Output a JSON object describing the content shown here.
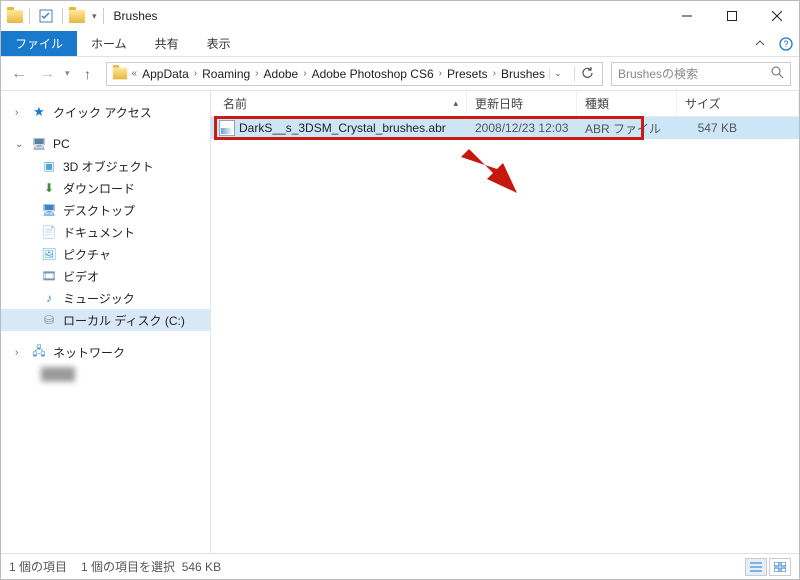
{
  "window": {
    "title": "Brushes"
  },
  "ribbon": {
    "file": "ファイル",
    "tabs": [
      "ホーム",
      "共有",
      "表示"
    ]
  },
  "breadcrumb": {
    "prefix": "«",
    "items": [
      "AppData",
      "Roaming",
      "Adobe",
      "Adobe Photoshop CS6",
      "Presets",
      "Brushes"
    ]
  },
  "search": {
    "placeholder": "Brushesの検索"
  },
  "sidebar": {
    "quick_access": "クイック アクセス",
    "pc": "PC",
    "pc_children": [
      "3D オブジェクト",
      "ダウンロード",
      "デスクトップ",
      "ドキュメント",
      "ピクチャ",
      "ビデオ",
      "ミュージック",
      "ローカル ディスク (C:)"
    ],
    "network": "ネットワーク"
  },
  "columns": {
    "name": "名前",
    "date": "更新日時",
    "type": "種類",
    "size": "サイズ"
  },
  "files": [
    {
      "name": "DarkS__s_3DSM_Crystal_brushes.abr",
      "date": "2008/12/23 12:03",
      "type": "ABR ファイル",
      "size": "547 KB"
    }
  ],
  "status": {
    "count": "1 個の項目",
    "selection": "1 個の項目を選択",
    "size": "546 KB"
  }
}
